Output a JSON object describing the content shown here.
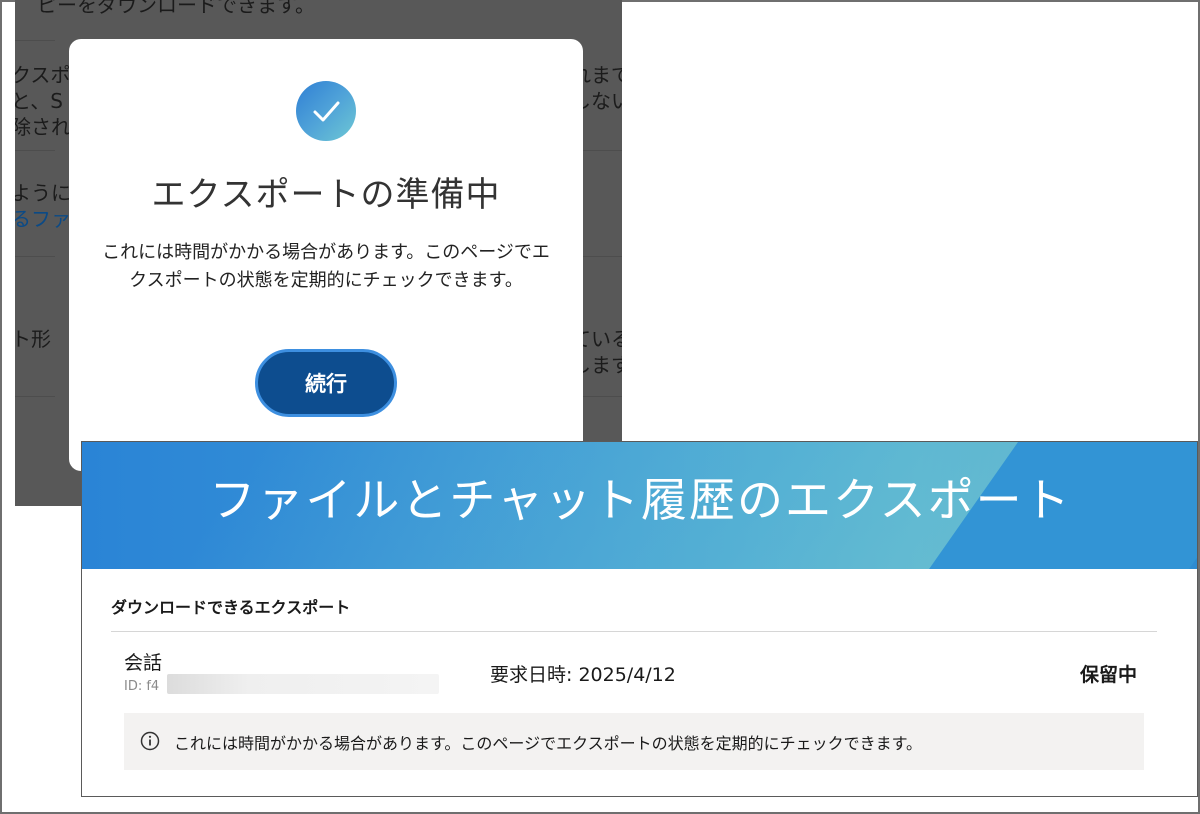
{
  "background_page": {
    "fragments": [
      "ピーをダウンロードできます。",
      "クスポ",
      "れまで",
      "と、S",
      "しない",
      "除され",
      "ように",
      "るファ",
      "ト形",
      "ている",
      "します"
    ]
  },
  "modal": {
    "title": "エクスポートの準備中",
    "description": "これには時間がかかる場合があります。このページでエクスポートの状態を定期的にチェックできます。",
    "continue_label": "続行",
    "icon": "checkmark-icon"
  },
  "export_panel": {
    "banner_title": "ファイルとチャット履歴のエクスポート",
    "section_heading": "ダウンロードできるエクスポート",
    "rows": [
      {
        "name": "会話",
        "id_label": "ID: f4",
        "requested": "要求日時: 2025/4/12",
        "status": "保留中"
      }
    ],
    "info_message": "これには時間がかかる場合があります。このページでエクスポートの状態を定期的にチェックできます。",
    "info_icon": "info-icon"
  },
  "colors": {
    "overlay": "#585858",
    "primary_button": "#0d4d8f",
    "button_border": "#3d8fe0",
    "banner_blue": "#2a84d6",
    "info_box_bg": "#f3f2f1"
  }
}
